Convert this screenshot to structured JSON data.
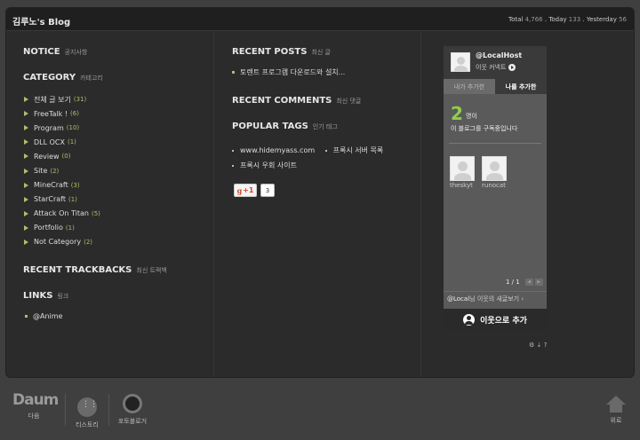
{
  "header": {
    "title": "김루노's Blog",
    "total_label": "Total",
    "total_value": "4,766",
    "today_label": "Today",
    "today_value": "133",
    "yesterday_label": "Yesterday",
    "yesterday_value": "56"
  },
  "left": {
    "notice": {
      "title": "NOTICE",
      "sub": "공지사항"
    },
    "category": {
      "title": "CATEGORY",
      "sub": "카테고리"
    },
    "categories": [
      {
        "name": "전체 글 보기",
        "count": "(31)"
      },
      {
        "name": "FreeTalk !",
        "count": "(6)"
      },
      {
        "name": "Program",
        "count": "(10)"
      },
      {
        "name": "DLL OCX",
        "count": "(1)"
      },
      {
        "name": "Review",
        "count": "(0)"
      },
      {
        "name": "Site",
        "count": "(2)"
      },
      {
        "name": "MineCraft",
        "count": "(3)"
      },
      {
        "name": "StarCraft",
        "count": "(1)"
      },
      {
        "name": "Attack On Titan",
        "count": "(5)"
      },
      {
        "name": "Portfolio",
        "count": "(1)"
      },
      {
        "name": "Not Category",
        "count": "(2)"
      }
    ],
    "trackbacks": {
      "title": "RECENT TRACKBACKS",
      "sub": "최신 트랙백"
    },
    "links": {
      "title": "LINKS",
      "sub": "링크"
    },
    "link_items": [
      "@Anime"
    ]
  },
  "middle": {
    "recent_posts": {
      "title": "RECENT POSTS",
      "sub": "최신 글"
    },
    "posts": [
      "토렌트 프로그램 다운로드와 설치..."
    ],
    "recent_comments": {
      "title": "RECENT COMMENTS",
      "sub": "최신 댓글"
    },
    "popular_tags": {
      "title": "POPULAR TAGS",
      "sub": "인기 태그"
    },
    "tags": [
      "www.hidemyass.com",
      "프록시 서버 목록",
      "프록시 우회 사이트"
    ],
    "gplus": {
      "label": "+1",
      "count": "3"
    }
  },
  "widget": {
    "name": "@LocalHost",
    "connect": "이웃 커넥트",
    "tab_mine": "내가 추가한",
    "tab_others": "나를 추가한",
    "count": "2",
    "unit": "명이",
    "message": "이 블로그를 구독중입니다",
    "friends": [
      "theskyt",
      "runocat"
    ],
    "pager": "1 / 1",
    "foot_who": "@Local",
    "foot_rest": "님 이웃의 새글보기",
    "add_button": "이웃으로 추가",
    "tools": "⚙ ⇣ ?"
  },
  "footer": {
    "daum_logo": "Daum",
    "daum": "다음",
    "tistory": "티스토리",
    "photo": "포토블로거",
    "top": "위로"
  }
}
